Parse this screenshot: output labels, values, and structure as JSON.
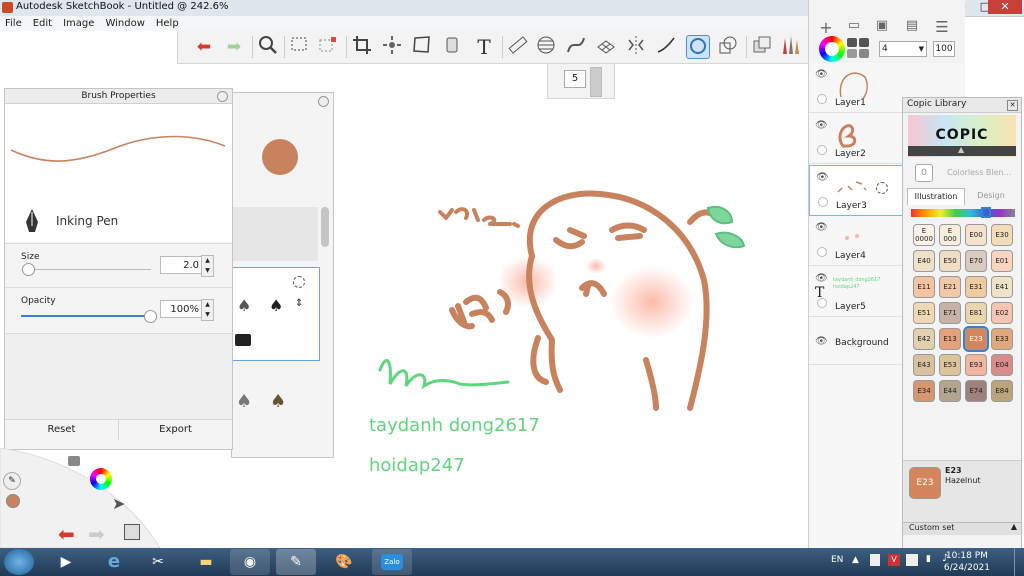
{
  "window": {
    "title": "Autodesk SketchBook - Untitled @ 242.6%",
    "minimize": "–",
    "maximize": "□",
    "close": "✕"
  },
  "menu": {
    "items": [
      "File",
      "Edit",
      "Image",
      "Window",
      "Help"
    ]
  },
  "toolbar": {
    "tools": [
      "undo-icon",
      "redo-icon",
      "zoom-icon",
      "select-rect-icon",
      "select-alt-icon",
      "crop-icon",
      "transform-icon",
      "distort-icon",
      "bucket-icon",
      "text-icon",
      "ruler-icon",
      "ellipse-guide-icon",
      "curve-icon",
      "perspective-icon",
      "symmetry-icon",
      "stroke-icon",
      "lasso-icon",
      "shapes-icon"
    ],
    "active_tool": "lasso-icon"
  },
  "size_popup": {
    "value": "5"
  },
  "right_top": {
    "opacity_select": "4",
    "opacity_value": "100"
  },
  "layers": [
    {
      "name": "Layer1",
      "selected": false
    },
    {
      "name": "Layer2",
      "selected": false
    },
    {
      "name": "Layer3",
      "selected": true
    },
    {
      "name": "Layer4",
      "selected": false
    },
    {
      "name": "Layer5",
      "selected": false,
      "type": "text",
      "preview": "taydanh dong2617 hoidap247"
    },
    {
      "name": "Background",
      "selected": false
    }
  ],
  "copic": {
    "title": "Copic Library",
    "logo_text": "COPIC",
    "colorless": "Colorless Blen...",
    "colorless_code": "0",
    "tabs": [
      "Illustration",
      "Design"
    ],
    "active_tab": "Illustration",
    "swatches": [
      {
        "code": "E\n0000",
        "color": "#fbf1e6"
      },
      {
        "code": "E\n000",
        "color": "#f8ecdc"
      },
      {
        "code": "E00",
        "color": "#f6e1cc"
      },
      {
        "code": "E30",
        "color": "#f4dcb8"
      },
      {
        "code": "E40",
        "color": "#efe0ca"
      },
      {
        "code": "E50",
        "color": "#f1dcc6"
      },
      {
        "code": "E70",
        "color": "#d9cbbf"
      },
      {
        "code": "E01",
        "color": "#f8d4c1"
      },
      {
        "code": "E11",
        "color": "#f6c39f"
      },
      {
        "code": "E21",
        "color": "#f3c8a7"
      },
      {
        "code": "E31",
        "color": "#f0caa0"
      },
      {
        "code": "E41",
        "color": "#eee2c9"
      },
      {
        "code": "E51",
        "color": "#f1d8b5"
      },
      {
        "code": "E71",
        "color": "#c7b2a5"
      },
      {
        "code": "E81",
        "color": "#e8d6ad"
      },
      {
        "code": "E02",
        "color": "#f5c4b2"
      },
      {
        "code": "E42",
        "color": "#e2d1b0"
      },
      {
        "code": "E13",
        "color": "#e6a07b"
      },
      {
        "code": "E23",
        "color": "#d5855c"
      },
      {
        "code": "E33",
        "color": "#e0a97d"
      },
      {
        "code": "E43",
        "color": "#d7c19f"
      },
      {
        "code": "E53",
        "color": "#dcc39b"
      },
      {
        "code": "E93",
        "color": "#f1b6a0"
      },
      {
        "code": "E04",
        "color": "#d98d8b"
      },
      {
        "code": "E34",
        "color": "#d5986e"
      },
      {
        "code": "E44",
        "color": "#b2a58d"
      },
      {
        "code": "E74",
        "color": "#9f827b"
      },
      {
        "code": "E84",
        "color": "#b9a47b"
      }
    ],
    "selected_code": "E23",
    "selected_name": "Hazelnut",
    "selected_color": "#d5855c",
    "footer": "Custom set"
  },
  "brush_properties": {
    "title": "Brush Properties",
    "brush_name": "Inking Pen",
    "size_label": "Size",
    "size_value": "2.0",
    "size_fraction": 0.03,
    "opacity_label": "Opacity",
    "opacity_value": "100%",
    "opacity_fraction": 1.0,
    "reset": "Reset",
    "export": "Export",
    "color": "#c8825e"
  },
  "canvas": {
    "text_line1": "taydanh dong2617",
    "text_line2": "hoidap247",
    "text_color": "#5fd67b",
    "ink_color": "#c8825e"
  },
  "taskbar": {
    "lang": "EN",
    "time": "10:18 PM",
    "date": "6/24/2021",
    "apps": [
      "media-player-icon",
      "ie-icon",
      "snipping-icon",
      "explorer-icon",
      "chrome-icon",
      "sketchbook-icon",
      "paint-icon",
      "zalo-icon"
    ],
    "zalo_label": "Zalo"
  }
}
